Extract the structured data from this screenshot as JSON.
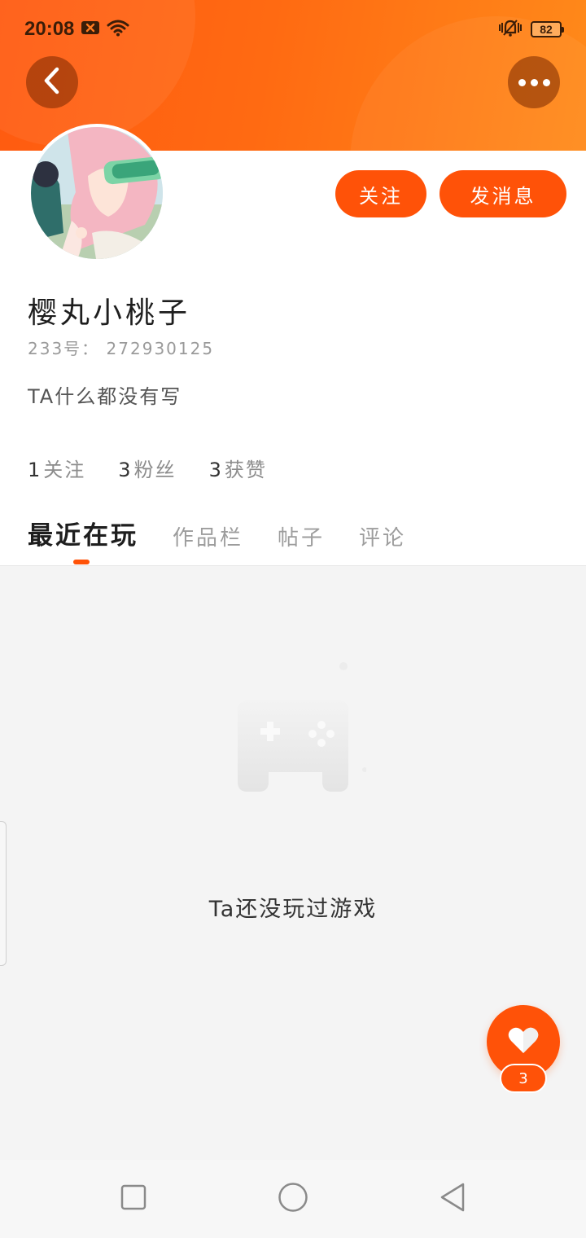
{
  "status_bar": {
    "time": "20:08",
    "battery": "82",
    "icons": [
      "close-box-icon",
      "wifi-icon",
      "vibrate-icon",
      "battery-icon"
    ]
  },
  "header": {
    "gradient_colors": [
      "#ff5a10",
      "#ff8a1a"
    ],
    "back_icon": "chevron-left-icon",
    "more_icon": "more-dots-icon"
  },
  "profile": {
    "username": "樱丸小桃子",
    "uid_label": "233号：",
    "uid_value": "272930125",
    "bio": "TA什么都没有写",
    "avatar_icon": "anime-avatar-image"
  },
  "actions": {
    "follow_label": "关注",
    "message_label": "发消息",
    "accent_color": "#ff5208"
  },
  "stats": [
    {
      "value": "1",
      "label": "关注"
    },
    {
      "value": "3",
      "label": "粉丝"
    },
    {
      "value": "3",
      "label": "获赞"
    }
  ],
  "tabs": [
    {
      "label": "最近在玩",
      "active": true
    },
    {
      "label": "作品栏",
      "active": false
    },
    {
      "label": "帖子",
      "active": false
    },
    {
      "label": "评论",
      "active": false
    }
  ],
  "empty_state": {
    "icon": "gamepad-icon",
    "text": "Ta还没玩过游戏"
  },
  "like": {
    "icon": "heart-icon",
    "count": "3"
  },
  "nav": {
    "icons": [
      "recent-apps-icon",
      "home-icon",
      "back-triangle-icon"
    ]
  }
}
